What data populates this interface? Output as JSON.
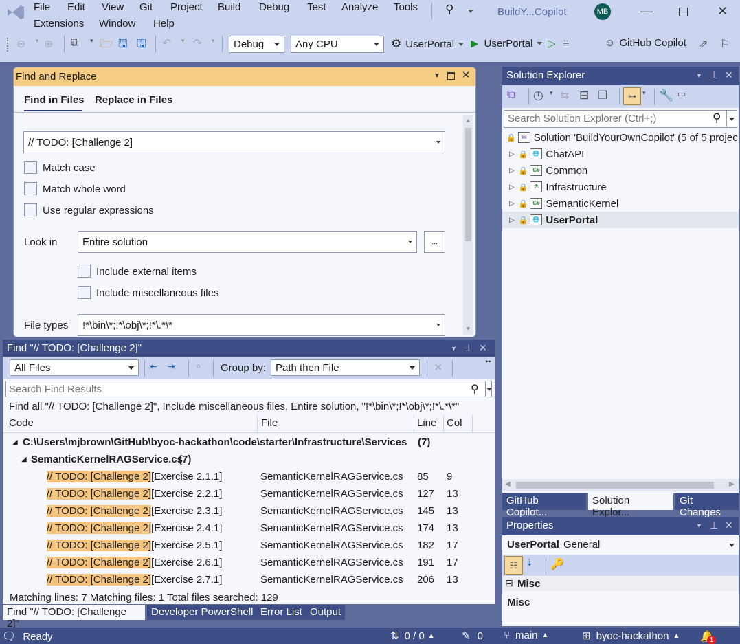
{
  "window": {
    "title": "BuildY...Copilot",
    "avatar_initials": "MB",
    "colors": {
      "accent": "#3e4f87",
      "highlight": "#f5c57f",
      "find_header": "#f5cc84",
      "avatar": "#0e5a52"
    }
  },
  "menu": {
    "items": [
      "File",
      "Edit",
      "View",
      "Git",
      "Project",
      "Build",
      "Debug",
      "Test",
      "Analyze",
      "Tools",
      "Extensions",
      "Window",
      "Help"
    ]
  },
  "toolbar": {
    "configuration": "Debug",
    "platform": "Any CPU",
    "startup_project": "UserPortal",
    "run_target": "UserPortal",
    "copilot_label": "GitHub Copilot"
  },
  "find_replace": {
    "title": "Find and Replace",
    "tabs": [
      "Find in Files",
      "Replace in Files"
    ],
    "active_tab": "Find in Files",
    "search_value": "// TODO: [Challenge 2]",
    "options": [
      {
        "label": "Match case",
        "checked": false
      },
      {
        "label": "Match whole word",
        "checked": false
      },
      {
        "label": "Use regular expressions",
        "checked": false
      }
    ],
    "look_in_label": "Look in",
    "look_in_value": "Entire solution",
    "browse_label": "...",
    "look_in_options": [
      {
        "label": "Include external items",
        "checked": false
      },
      {
        "label": "Include miscellaneous files",
        "checked": false
      }
    ],
    "file_types_label": "File types",
    "file_types_value": "!*\\bin\\*;!*\\obj\\*;!*\\.*\\*"
  },
  "find_results": {
    "title": "Find \"// TODO: [Challenge 2]\"",
    "scope_filter": "All Files",
    "group_by_label": "Group by:",
    "group_by_value": "Path then File",
    "search_placeholder": "Search Find Results",
    "summary": "Find all \"// TODO: [Challenge 2]\", Include miscellaneous files, Entire solution, \"!*\\bin\\*;!*\\obj\\*;!*\\.*\\*\"",
    "columns": [
      "Code",
      "File",
      "Line",
      "Col"
    ],
    "path_group": "C:\\Users\\mjbrown\\GitHub\\byoc-hackathon\\code\\starter\\Infrastructure\\Services",
    "path_count": "(7)",
    "file_group": "SemanticKernelRAGService.cs",
    "file_count": "(7)",
    "rows": [
      {
        "match": "// TODO: [Challenge 2]",
        "rest": "[Exercise 2.1.1]",
        "file": "SemanticKernelRAGService.cs",
        "line": "85",
        "col": "9"
      },
      {
        "match": "// TODO: [Challenge 2]",
        "rest": "[Exercise 2.2.1]",
        "file": "SemanticKernelRAGService.cs",
        "line": "127",
        "col": "13"
      },
      {
        "match": "// TODO: [Challenge 2]",
        "rest": "[Exercise 2.3.1]",
        "file": "SemanticKernelRAGService.cs",
        "line": "145",
        "col": "13"
      },
      {
        "match": "// TODO: [Challenge 2]",
        "rest": "[Exercise 2.4.1]",
        "file": "SemanticKernelRAGService.cs",
        "line": "174",
        "col": "13"
      },
      {
        "match": "// TODO: [Challenge 2]",
        "rest": "[Exercise 2.5.1]",
        "file": "SemanticKernelRAGService.cs",
        "line": "182",
        "col": "17"
      },
      {
        "match": "// TODO: [Challenge 2]",
        "rest": "[Exercise 2.6.1]",
        "file": "SemanticKernelRAGService.cs",
        "line": "191",
        "col": "17"
      },
      {
        "match": "// TODO: [Challenge 2]",
        "rest": "[Exercise 2.7.1]",
        "file": "SemanticKernelRAGService.cs",
        "line": "206",
        "col": "13"
      }
    ],
    "footer": "Matching lines: 7 Matching files: 1 Total files searched: 129"
  },
  "bottom_tabs": [
    "Find \"// TODO: [Challenge 2]\"",
    "Developer PowerShell",
    "Error List",
    "Output"
  ],
  "solution_explorer": {
    "title": "Solution Explorer",
    "search_placeholder": "Search Solution Explorer (Ctrl+;)",
    "solution_label": "Solution 'BuildYourOwnCopilot' (5 of 5 projec",
    "projects": [
      {
        "name": "ChatAPI",
        "icon": "web-project-icon"
      },
      {
        "name": "Common",
        "icon": "csharp-project-icon"
      },
      {
        "name": "Infrastructure",
        "icon": "test-project-icon"
      },
      {
        "name": "SemanticKernel",
        "icon": "csharp-project-icon"
      },
      {
        "name": "UserPortal",
        "icon": "web-project-icon",
        "bold": true
      }
    ],
    "tabs": [
      "GitHub Copilot...",
      "Solution Explor...",
      "Git Changes"
    ]
  },
  "properties": {
    "title": "Properties",
    "object_name": "UserPortal",
    "object_type": "General",
    "category": "Misc",
    "description_title": "Misc"
  },
  "status_bar": {
    "state": "Ready",
    "sync": "0 / 0",
    "edits": "0",
    "branch": "main",
    "repo": "byoc-hackathon",
    "notifications": "1"
  }
}
